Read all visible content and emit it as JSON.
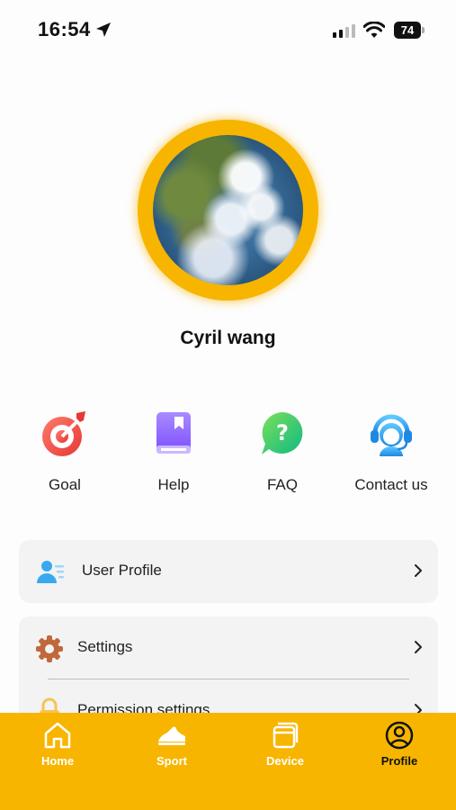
{
  "status_bar": {
    "time": "16:54",
    "battery": "74"
  },
  "profile": {
    "name": "Cyril wang"
  },
  "quick_actions": [
    {
      "label": "Goal",
      "icon": "target-icon"
    },
    {
      "label": "Help",
      "icon": "book-icon"
    },
    {
      "label": "FAQ",
      "icon": "question-bubble-icon"
    },
    {
      "label": "Contact us",
      "icon": "headset-icon"
    }
  ],
  "menu": {
    "user_profile": "User Profile",
    "settings": "Settings",
    "permission_settings": "Permission settings"
  },
  "tabs": [
    {
      "label": "Home",
      "icon": "home-icon"
    },
    {
      "label": "Sport",
      "icon": "sneaker-icon"
    },
    {
      "label": "Device",
      "icon": "device-icon"
    },
    {
      "label": "Profile",
      "icon": "profile-icon",
      "active": true
    }
  ],
  "colors": {
    "accent": "#f7b500",
    "card": "#f3f3f3",
    "text": "#222222"
  }
}
